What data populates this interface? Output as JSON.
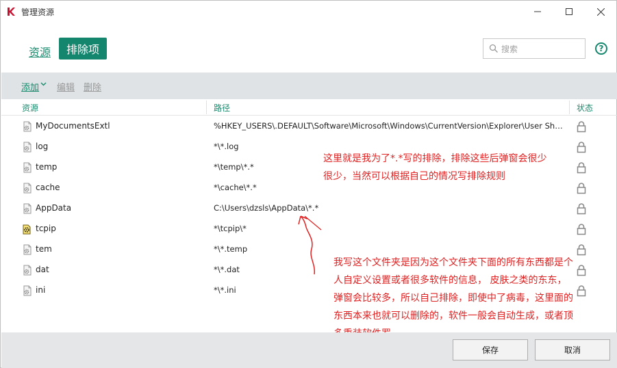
{
  "window": {
    "title": "管理资源",
    "logo_color": "#c8102e"
  },
  "tabs": {
    "resources": "资源",
    "exclusions": "排除项"
  },
  "search": {
    "placeholder": "搜索"
  },
  "help_label": "?",
  "toolbar": {
    "add": "添加",
    "edit": "编辑",
    "delete": "删除"
  },
  "table": {
    "headers": {
      "resource": "资源",
      "path": "路径",
      "status": "状态"
    },
    "rows": [
      {
        "name": "MyDocumentsExtl",
        "path": "%HKEY_USERS\\.DEFAULT\\Software\\Microsoft\\Windows\\CurrentVersion\\Explorer\\User Shell Fol...",
        "icon": "gear-file-icon"
      },
      {
        "name": "log",
        "path": "*\\*.log",
        "icon": "gear-file-icon"
      },
      {
        "name": "temp",
        "path": "*\\temp\\*.*",
        "icon": "gear-file-icon"
      },
      {
        "name": "cache",
        "path": "*\\cache\\*.*",
        "icon": "gear-file-icon"
      },
      {
        "name": "AppData",
        "path": "C:\\Users\\dzsls\\AppData\\*.*",
        "icon": "gear-file-icon"
      },
      {
        "name": "tcpip",
        "path": "*\\tcpip\\*",
        "icon": "tcpip-icon"
      },
      {
        "name": "tem",
        "path": "*\\*.temp",
        "icon": "gear-file-icon"
      },
      {
        "name": "dat",
        "path": "*\\*.dat",
        "icon": "gear-file-icon"
      },
      {
        "name": "ini",
        "path": "*\\*.ini",
        "icon": "gear-file-icon"
      }
    ]
  },
  "annotations": {
    "note1": "这里就是我为了*.*写的排除，排除这些后弹窗会很少很少，当然可以根据自己的情况写排除规则",
    "note2": "我写这个文件夹是因为这个文件夹下面的所有东西都是个人自定义设置或者很多软件的信息， 皮肤之类的东东，弹窗会比较多，所以自己排除，即使中了病毒，这里面的东西本来也就可以删除的，软件一般会自动生成，或者顶多重装软件罗",
    "color": "#e02020"
  },
  "footer": {
    "save": "保存",
    "cancel": "取消"
  },
  "colors": {
    "accent": "#14866d",
    "toolbar_bg": "#dfe3e5",
    "footer_bg": "#e4e6e8"
  }
}
